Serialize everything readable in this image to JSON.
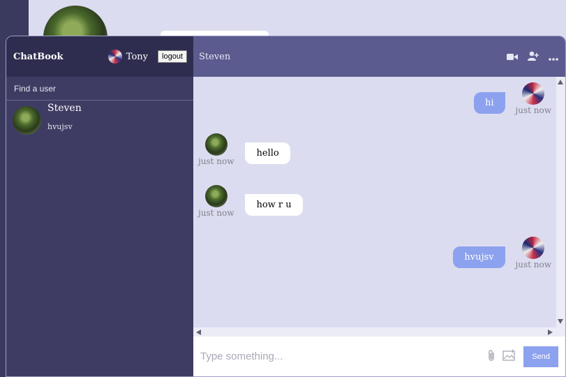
{
  "app": {
    "name": "ChatBook"
  },
  "navbar": {
    "username": "Tony",
    "logout_label": "logout"
  },
  "search": {
    "placeholder": "Find a user"
  },
  "chats": [
    {
      "name": "Steven",
      "last_message": "hvujsv"
    }
  ],
  "chat_header": {
    "title": "Steven",
    "icons": [
      "video-icon",
      "add-user-icon",
      "more-icon"
    ]
  },
  "messages": [
    {
      "text": "hi",
      "time": "just now",
      "owner": true
    },
    {
      "text": "hello",
      "time": "just now",
      "owner": false
    },
    {
      "text": "how r u",
      "time": "just now",
      "owner": false
    },
    {
      "text": "hvujsv",
      "time": "just now",
      "owner": true
    }
  ],
  "input": {
    "placeholder": "Type something...",
    "send_label": "Send"
  },
  "colors": {
    "sidebar": "#3e3c63",
    "navbar": "#2f2d4f",
    "chat_header": "#5c5b8f",
    "chat_bg": "#dcdcf1",
    "own_bubble": "#8da2ee"
  }
}
